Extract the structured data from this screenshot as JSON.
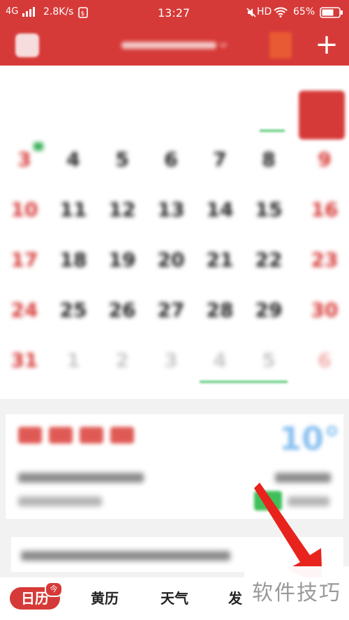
{
  "status_bar": {
    "network": "4G",
    "speed": "2.8K/s",
    "time": "13:27",
    "hd": "HD",
    "battery": "65%"
  },
  "header": {
    "add_label": "+"
  },
  "calendar": {
    "weekdays": [
      "",
      "",
      "",
      "",
      "",
      "",
      ""
    ],
    "rows": [
      [
        {
          "d": "",
          "out": true
        },
        {
          "d": "",
          "out": true
        },
        {
          "d": "",
          "out": true
        },
        {
          "d": "",
          "out": true
        },
        {
          "d": "",
          "out": true
        },
        {
          "d": "",
          "out": true
        },
        {
          "d": "",
          "out": false
        }
      ],
      [
        {
          "d": "3"
        },
        {
          "d": "4"
        },
        {
          "d": "5"
        },
        {
          "d": "6"
        },
        {
          "d": "7"
        },
        {
          "d": "8"
        },
        {
          "d": "9"
        }
      ],
      [
        {
          "d": "10"
        },
        {
          "d": "11"
        },
        {
          "d": "12"
        },
        {
          "d": "13"
        },
        {
          "d": "14"
        },
        {
          "d": "15"
        },
        {
          "d": "16"
        }
      ],
      [
        {
          "d": "17"
        },
        {
          "d": "18"
        },
        {
          "d": "19"
        },
        {
          "d": "20"
        },
        {
          "d": "21"
        },
        {
          "d": "22"
        },
        {
          "d": "23"
        }
      ],
      [
        {
          "d": "24"
        },
        {
          "d": "25"
        },
        {
          "d": "26"
        },
        {
          "d": "27"
        },
        {
          "d": "28"
        },
        {
          "d": "29"
        },
        {
          "d": "30"
        }
      ],
      [
        {
          "d": "31"
        },
        {
          "d": "1",
          "out": true
        },
        {
          "d": "2",
          "out": true
        },
        {
          "d": "3",
          "out": true
        },
        {
          "d": "4",
          "out": true
        },
        {
          "d": "5",
          "out": true
        },
        {
          "d": "6",
          "out": true
        }
      ]
    ]
  },
  "weather": {
    "temperature": "10°"
  },
  "tabs": [
    {
      "label": "日历",
      "active": true,
      "badge": "今"
    },
    {
      "label": "黄历"
    },
    {
      "label": "天气"
    },
    {
      "label": "发"
    }
  ],
  "watermark": "软件技巧",
  "colors": {
    "brand": "#d63a38",
    "accent_green": "#3bb05a",
    "arrow": "#e8231d"
  }
}
